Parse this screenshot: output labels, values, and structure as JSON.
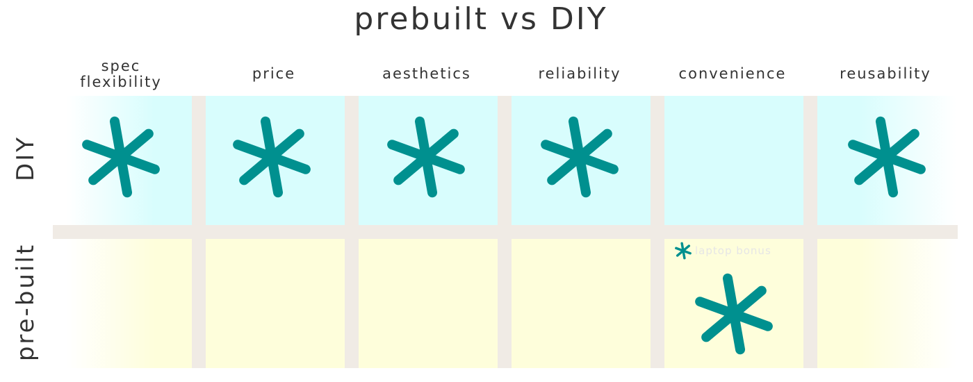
{
  "title": "prebuilt vs DIY",
  "colors": {
    "asterisk": "#00908f",
    "diy_cell": "#d8fdfd",
    "prebuilt_cell": "#fefedb",
    "gutter": "#f0ebe5",
    "text": "#333333"
  },
  "columns": [
    {
      "label": "spec\nflexibility",
      "winner": "diy"
    },
    {
      "label": "price",
      "winner": "diy"
    },
    {
      "label": "aesthetics",
      "winner": "diy"
    },
    {
      "label": "reliability",
      "winner": "diy"
    },
    {
      "label": "convenience",
      "winner": "prebuilt"
    },
    {
      "label": "reusability",
      "winner": "diy"
    }
  ],
  "rows": [
    {
      "label": "DIY"
    },
    {
      "label": "pre-built"
    }
  ],
  "note": {
    "icon": "asterisk-icon",
    "text": "laptop bonus"
  }
}
